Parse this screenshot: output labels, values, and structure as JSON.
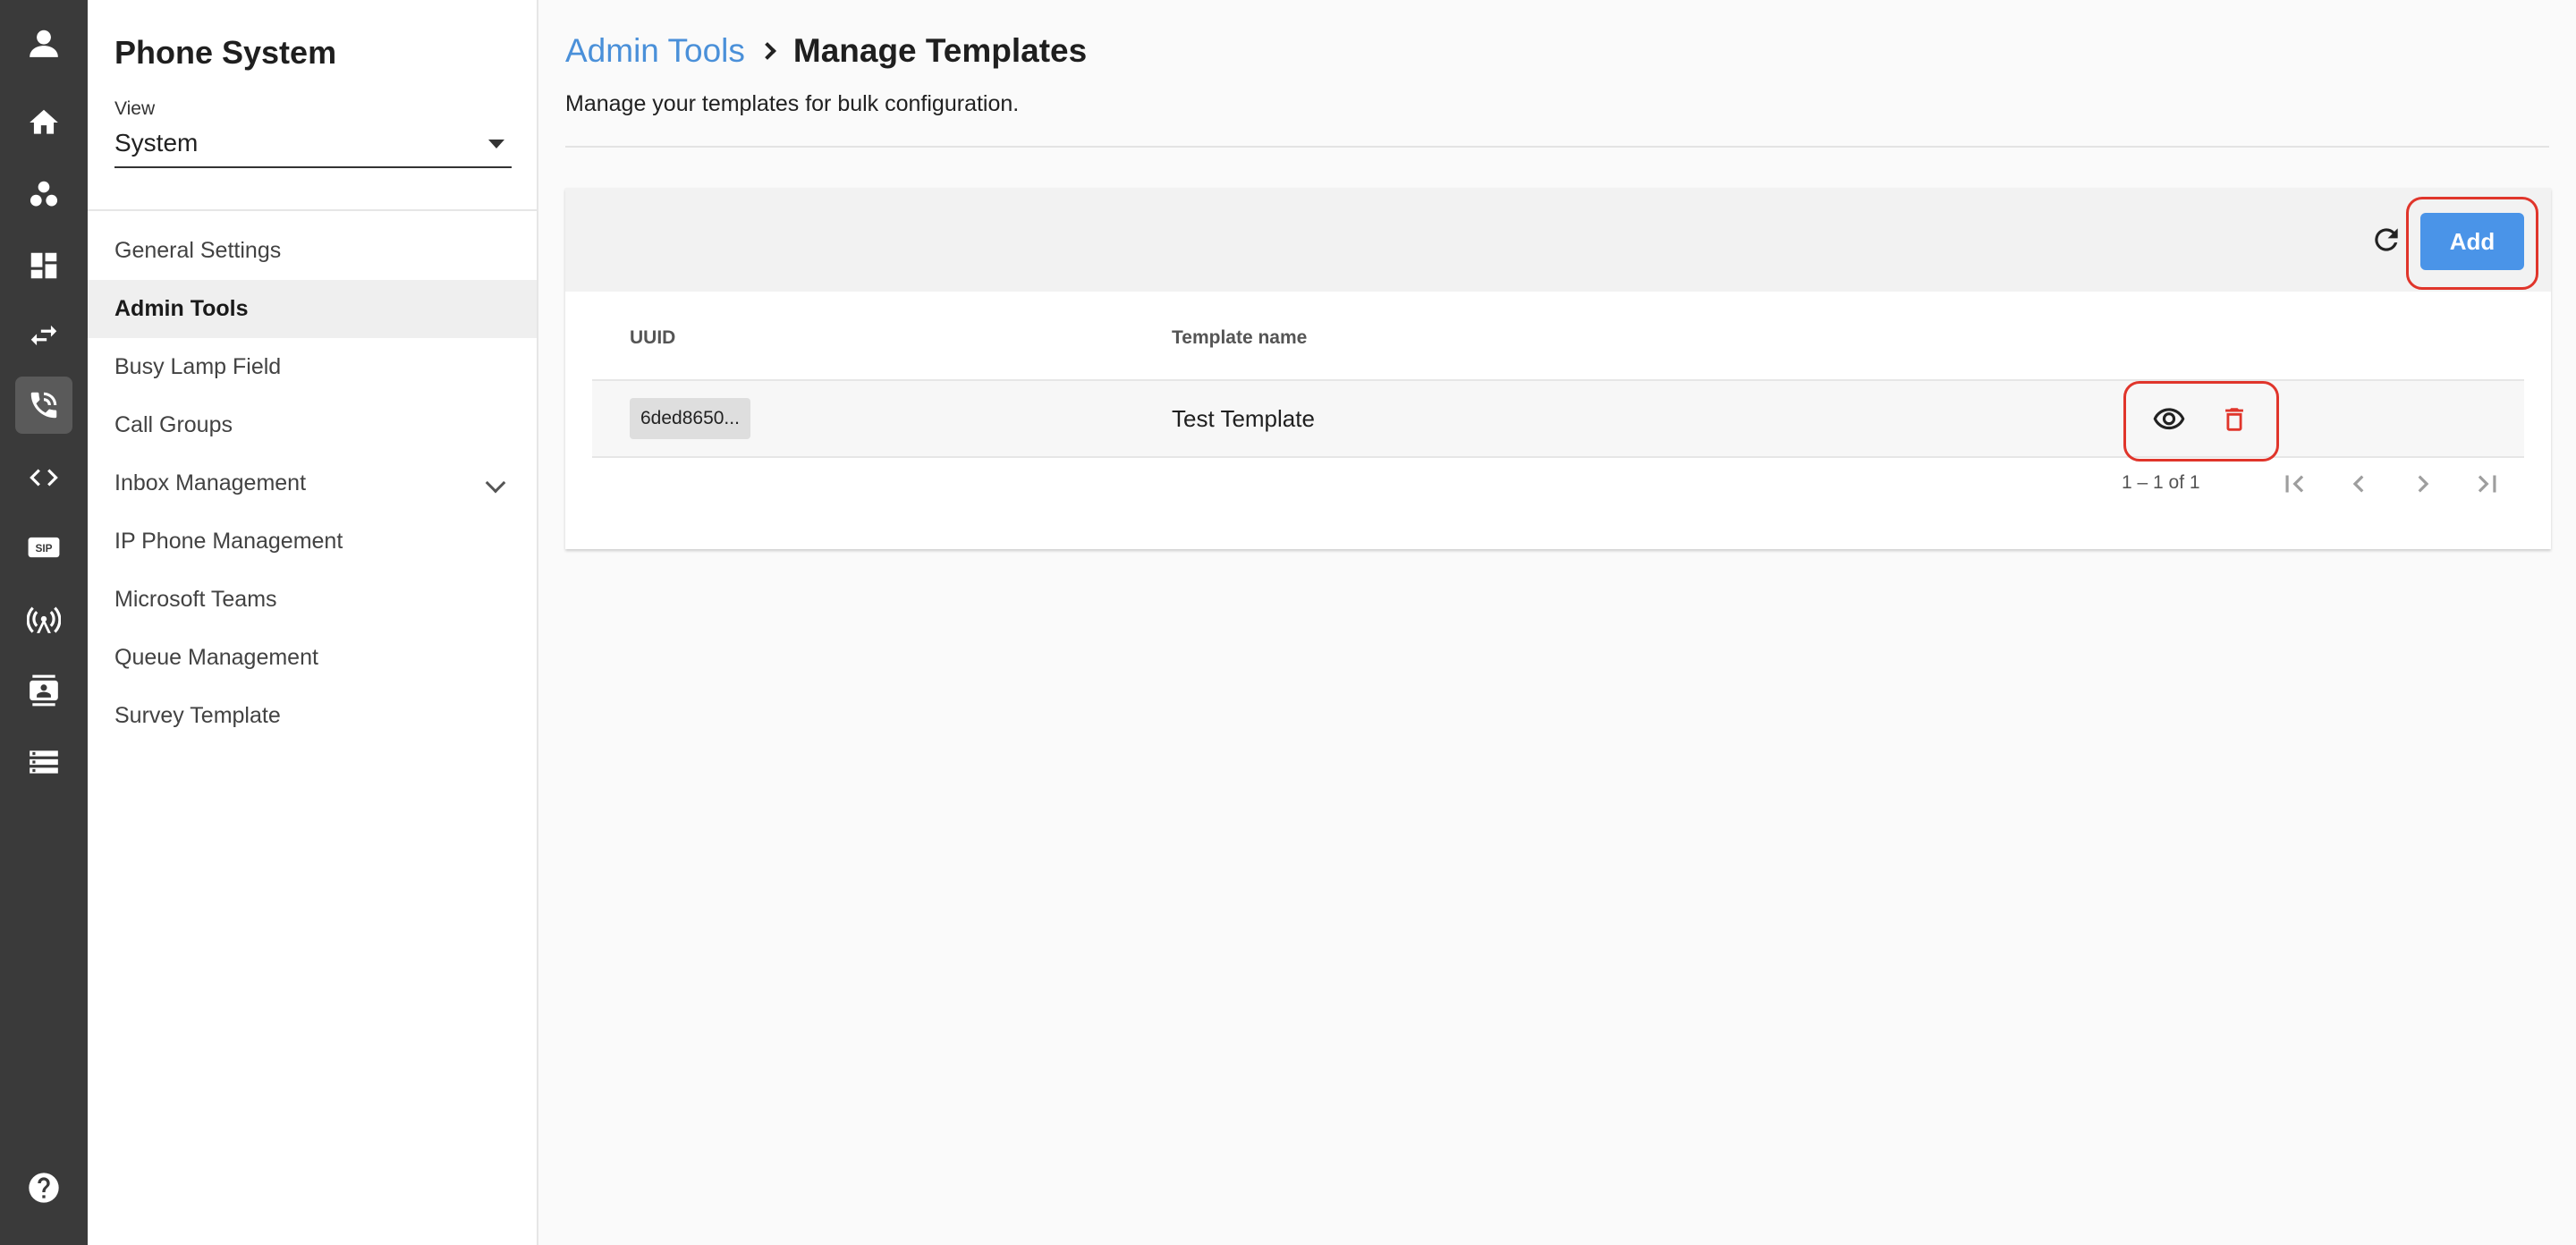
{
  "rail": {
    "items": [
      {
        "icon": "user-icon"
      },
      {
        "icon": "home-icon"
      },
      {
        "icon": "group-icon"
      },
      {
        "icon": "dashboard-icon"
      },
      {
        "icon": "transfer-icon"
      },
      {
        "icon": "phone-icon",
        "active": true
      },
      {
        "icon": "code-icon"
      },
      {
        "icon": "sip-icon",
        "text": "SIP"
      },
      {
        "icon": "antenna-icon"
      },
      {
        "icon": "contact-card-icon"
      },
      {
        "icon": "server-list-icon"
      }
    ],
    "help_icon": "help-icon"
  },
  "subnav": {
    "title": "Phone System",
    "view_label": "View",
    "view_value": "System",
    "items": [
      {
        "label": "General Settings"
      },
      {
        "label": "Admin Tools",
        "active": true
      },
      {
        "label": "Busy Lamp Field"
      },
      {
        "label": "Call Groups"
      },
      {
        "label": "Inbox Management",
        "expandable": true
      },
      {
        "label": "IP Phone Management"
      },
      {
        "label": "Microsoft Teams"
      },
      {
        "label": "Queue Management"
      },
      {
        "label": "Survey Template"
      }
    ]
  },
  "header": {
    "breadcrumb_parent": "Admin Tools",
    "breadcrumb_current": "Manage Templates",
    "description": "Manage your templates for bulk configuration."
  },
  "toolbar": {
    "refresh_icon": "refresh-icon",
    "add_label": "Add"
  },
  "table": {
    "columns": [
      "UUID",
      "Template name"
    ],
    "rows": [
      {
        "uuid": "6ded8650...",
        "name": "Test Template"
      }
    ]
  },
  "pagination": {
    "range_text": "1 – 1 of 1"
  },
  "colors": {
    "accent": "#4a94e8",
    "link": "#4a90d9",
    "danger": "#e0352b",
    "rail": "#3a3a3a"
  }
}
